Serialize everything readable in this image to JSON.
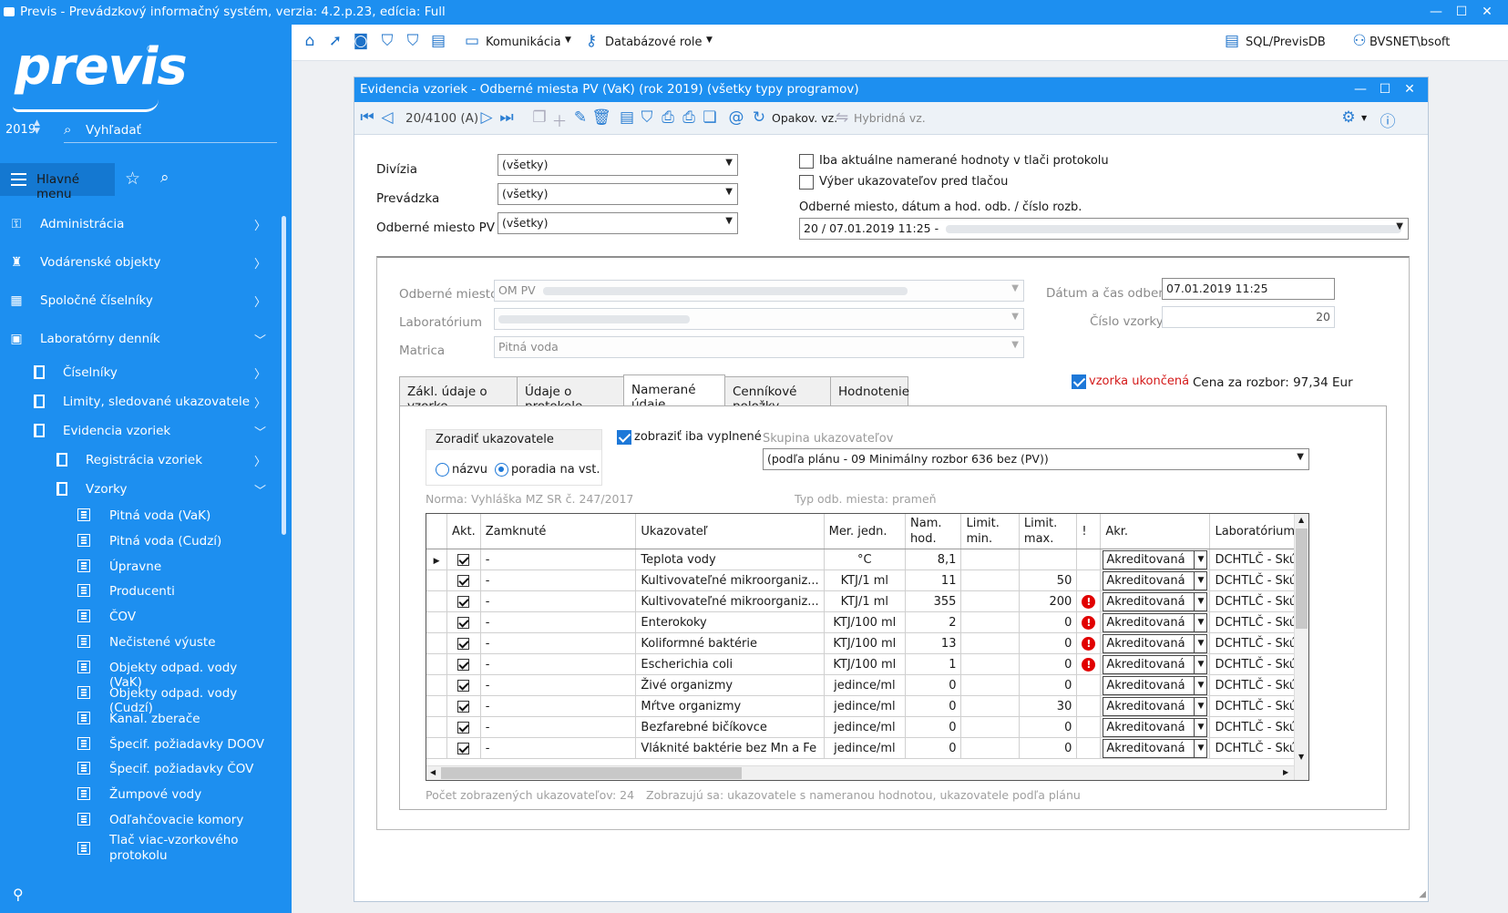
{
  "window": {
    "title": "Previs - Prevádzkový informačný systém, verzia: 4.2.p.23, edícia: Full"
  },
  "sidebar": {
    "logo": "previs",
    "year": "2019",
    "search_placeholder": "Vyhľadať",
    "main_menu_label": "Hlavné menu",
    "items": [
      {
        "label": "Administrácia",
        "icon": "key-icon"
      },
      {
        "label": "Vodárenské objekty",
        "icon": "building-icon"
      },
      {
        "label": "Spoločné číselníky",
        "icon": "codebook-icon"
      },
      {
        "label": "Laboratórny denník",
        "icon": "lab-journal-icon"
      },
      {
        "label": "Číselníky",
        "icon": "document-icon"
      },
      {
        "label": "Limity, sledované ukazovatele",
        "icon": "document-icon"
      },
      {
        "label": "Evidencia vzoriek",
        "icon": "document-icon"
      },
      {
        "label": "Registrácia vzoriek",
        "icon": "document-icon"
      },
      {
        "label": "Vzorky",
        "icon": "document-icon"
      },
      {
        "label": "Pitná voda (VaK)",
        "icon": "list-icon"
      },
      {
        "label": "Pitná voda (Cudzí)",
        "icon": "list-icon"
      },
      {
        "label": "Úpravne",
        "icon": "list-icon"
      },
      {
        "label": "Producenti",
        "icon": "list-icon"
      },
      {
        "label": "ČOV",
        "icon": "list-icon"
      },
      {
        "label": "Nečistené výuste",
        "icon": "list-icon"
      },
      {
        "label": "Objekty odpad. vody (VaK)",
        "icon": "list-icon"
      },
      {
        "label": "Objekty odpad. vody (Cudzí)",
        "icon": "list-icon"
      },
      {
        "label": "Kanal. zberače",
        "icon": "list-icon"
      },
      {
        "label": "Špecif. požiadavky DOOV",
        "icon": "list-icon"
      },
      {
        "label": "Špecif. požiadavky ČOV",
        "icon": "list-icon"
      },
      {
        "label": "Žumpové vody",
        "icon": "list-icon"
      },
      {
        "label": "Odľahčovacie komory",
        "icon": "list-icon"
      },
      {
        "label": "Tlač viac-vzorkového",
        "label2": "protokolu",
        "icon": "list-icon"
      }
    ]
  },
  "toolbar": {
    "communication": "Komunikácia",
    "db_roles": "Databázové role",
    "db": "SQL/PrevisDB",
    "user": "BVSNET\\bsoft"
  },
  "inner": {
    "title": "Evidencia vzoriek - Odberné miesta PV (VaK) (rok 2019) (všetky typy programov)",
    "record_counter": "20/4100 (A)",
    "repeat_label": "Opakov. vz.",
    "hybrid_label": "Hybridná vz."
  },
  "filters": {
    "division_label": "Divízia",
    "division_value": "(všetky)",
    "operation_label": "Prevádzka",
    "operation_value": "(všetky)",
    "site_label": "Odberné miesto PV",
    "site_value": "(všetky)",
    "chk_actual": "Iba aktuálne namerané hodnoty v tlači protokolu",
    "chk_select": "Výber ukazovateľov pred tlačou",
    "sample_select_label": "Odberné miesto, dátum a hod. odb. / číslo rozb.",
    "sample_select_value": "20 / 07.01.2019 11:25 -"
  },
  "detail": {
    "om_label": "Odberné miesto",
    "om_value": "OM PV",
    "lab_label": "Laboratórium",
    "matrix_label": "Matrica",
    "matrix_value": "Pitná voda",
    "date_label": "Dátum a čas odberu",
    "date_value": "07.01.2019 11:25",
    "num_label": "Číslo vzorky",
    "num_value": "20",
    "finished_label": "vzorka ukončená",
    "price": "Cena za rozbor: 97,34 Eur"
  },
  "tabs": [
    "Zákl. údaje o vzorke",
    "Údaje o protokole",
    "Namerané údaje",
    "Cenníkové položky",
    "Hodnotenie"
  ],
  "measured": {
    "sort_title": "Zoradiť ukazovatele",
    "sort_by_name": "názvu",
    "sort_by_order": "poradia na vst.",
    "show_filled": "zobraziť iba vyplnené",
    "group_label": "Skupina ukazovateľov",
    "group_value": "(podľa plánu - 09 Minimálny rozbor 636 bez (PV))",
    "norm": "Norma:   Vyhláška MZ SR č. 247/2017",
    "site_type": "Typ odb. miesta: prameň",
    "footer_count": "Počet zobrazených ukazovateľov: 24",
    "footer_note": "Zobrazujú sa: ukazovatele s nameranou hodnotou, ukazovatele podľa plánu",
    "columns": [
      "Akt.",
      "Zamknuté",
      "Ukazovateľ",
      "Mer. jedn.",
      "Nam. hod.",
      "Limit. min.",
      "Limit. max.",
      "!",
      "Akr.",
      "Laboratórium"
    ],
    "rows": [
      {
        "locked": "-",
        "name": "Teplota vody",
        "unit": "°C",
        "value": "8,1",
        "min": "",
        "max": "",
        "warn": false,
        "akr": "Akreditovaná",
        "lab": "DCHTLČ - Skúš"
      },
      {
        "locked": "-",
        "name": "Kultivovateľné mikroorganiz...",
        "unit": "KTJ/1 ml",
        "value": "11",
        "min": "",
        "max": "50",
        "warn": false,
        "akr": "Akreditovaná",
        "lab": "DCHTLČ - Skúš"
      },
      {
        "locked": "-",
        "name": "Kultivovateľné mikroorganiz...",
        "unit": "KTJ/1 ml",
        "value": "355",
        "min": "",
        "max": "200",
        "warn": true,
        "akr": "Akreditovaná",
        "lab": "DCHTLČ - Skúš"
      },
      {
        "locked": "-",
        "name": "Enterokoky",
        "unit": "KTJ/100 ml",
        "value": "2",
        "min": "",
        "max": "0",
        "warn": true,
        "akr": "Akreditovaná",
        "lab": "DCHTLČ - Skúš"
      },
      {
        "locked": "-",
        "name": "Koliformné baktérie",
        "unit": "KTJ/100 ml",
        "value": "13",
        "min": "",
        "max": "0",
        "warn": true,
        "akr": "Akreditovaná",
        "lab": "DCHTLČ - Skúš"
      },
      {
        "locked": "-",
        "name": "Escherichia coli",
        "unit": "KTJ/100 ml",
        "value": "1",
        "min": "",
        "max": "0",
        "warn": true,
        "akr": "Akreditovaná",
        "lab": "DCHTLČ - Skúš"
      },
      {
        "locked": "-",
        "name": "Živé organizmy",
        "unit": "jedince/ml",
        "value": "0",
        "min": "",
        "max": "0",
        "warn": false,
        "akr": "Akreditovaná",
        "lab": "DCHTLČ - Skúš"
      },
      {
        "locked": "-",
        "name": "Mŕtve organizmy",
        "unit": "jedince/ml",
        "value": "0",
        "min": "",
        "max": "30",
        "warn": false,
        "akr": "Akreditovaná",
        "lab": "DCHTLČ - Skúš"
      },
      {
        "locked": "-",
        "name": "Bezfarebné bičíkovce",
        "unit": "jedince/ml",
        "value": "0",
        "min": "",
        "max": "0",
        "warn": false,
        "akr": "Akreditovaná",
        "lab": "DCHTLČ - Skúš"
      },
      {
        "locked": "-",
        "name": "Vláknité baktérie bez Mn a Fe",
        "unit": "jedince/ml",
        "value": "0",
        "min": "",
        "max": "0",
        "warn": false,
        "akr": "Akreditovaná",
        "lab": "DCHTLČ - Skúš"
      }
    ]
  }
}
